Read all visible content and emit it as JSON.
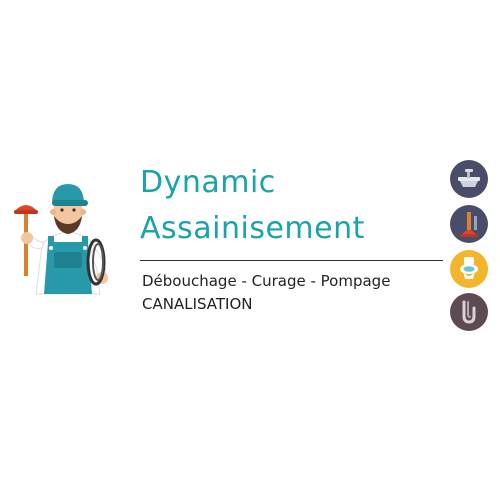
{
  "brand": {
    "line1": "Dynamic",
    "line2": "Assainisement"
  },
  "tagline": {
    "services": "Débouchage - Curage - Pompage",
    "category": "CANALISATION"
  },
  "icons": {
    "mascot": "plumber-with-plunger-icon",
    "badges": [
      "sink-faucet-icon",
      "plunger-icon",
      "toilet-icon",
      "drain-pipe-icon"
    ]
  },
  "colors": {
    "brand_teal": "#1aa3a8",
    "text_dark": "#222222",
    "divider": "#333333",
    "badge_bg": "#4a4d6a",
    "badge_highlight": "#f2b52c",
    "plunger_red": "#e2452f",
    "overall_teal": "#2899a8",
    "skin": "#f3c6a2",
    "beard": "#5a3a22"
  }
}
